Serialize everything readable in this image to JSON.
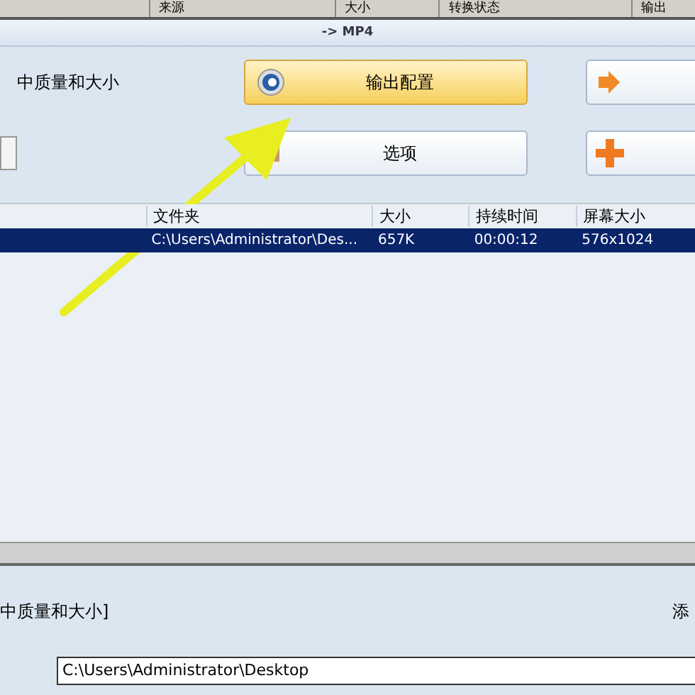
{
  "top_table": {
    "columns": [
      "来源",
      "大小",
      "转换状态",
      "输出"
    ]
  },
  "format_bar": {
    "title": "-> MP4"
  },
  "profile": {
    "quality": "中质量和大小"
  },
  "buttons": [
    {
      "label": "输出配置",
      "kind": "settings",
      "highlighted": true
    },
    {
      "label": "选项",
      "kind": "options",
      "highlighted": false
    }
  ],
  "file_list": {
    "columns": [
      "",
      "文件夹",
      "大小",
      "持续时间",
      "屏幕大小"
    ],
    "rows": [
      {
        "selected": true,
        "cells": [
          "",
          "C:\\Users\\Administrator\\Des...",
          "657K",
          "00:00:12",
          "576x1024"
        ]
      }
    ]
  },
  "bottom_panel": {
    "quality": "中质量和大小]",
    "add_label": "添",
    "output_folder": "C:\\Users\\Administrator\\Desktop"
  }
}
